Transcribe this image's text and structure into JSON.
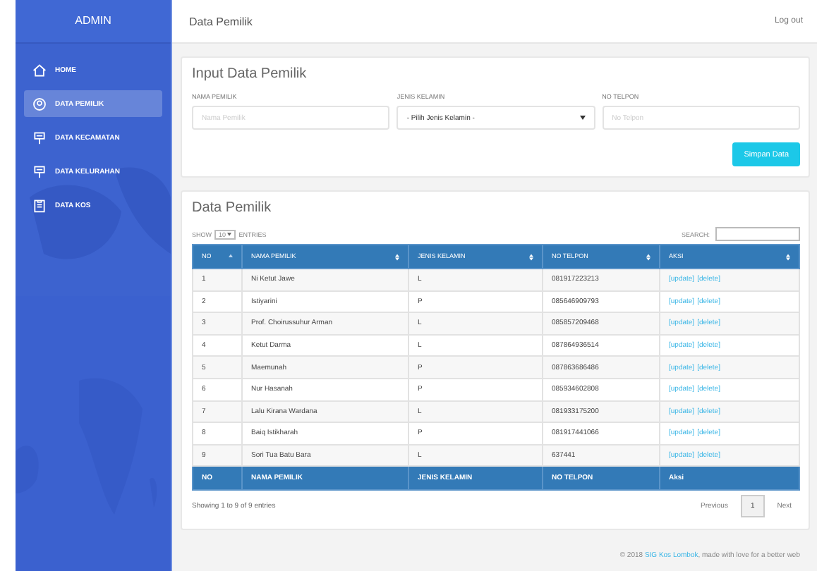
{
  "sidebar": {
    "title": "ADMIN",
    "items": [
      {
        "label": "HOME",
        "selected": false
      },
      {
        "label": "DATA PEMILIK",
        "selected": true
      },
      {
        "label": "DATA KECAMATAN",
        "selected": false
      },
      {
        "label": "DATA KELURAHAN",
        "selected": false
      },
      {
        "label": "DATA KOS",
        "selected": false
      }
    ]
  },
  "header": {
    "title": "Data Pemilik",
    "logout": "Log out"
  },
  "form": {
    "title": "Input Data Pemilik",
    "fields": [
      {
        "kind": "text",
        "label": "NAMA PEMILIK",
        "placeholder": "Nama Pemilik"
      },
      {
        "kind": "select",
        "label": "JENIS KELAMIN",
        "value": "- Pilih Jenis Kelamin -"
      },
      {
        "kind": "text",
        "label": "NO TELPON",
        "placeholder": "No Telpon"
      }
    ],
    "submit": "Simpan Data"
  },
  "table": {
    "title": "Data Pemilik",
    "show_label": "SHOW",
    "page_size": "10",
    "entries_label": "ENTRIES",
    "search_label": "SEARCH:",
    "columns": [
      {
        "label": "NO",
        "sorted": true
      },
      {
        "label": "NAMA PEMILIK",
        "sorted": false
      },
      {
        "label": "JENIS KELAMIN",
        "sorted": false
      },
      {
        "label": "NO TELPON",
        "sorted": false
      },
      {
        "label": "AKSI",
        "sorted": false
      }
    ],
    "rows": [
      {
        "cells": [
          "1",
          "Ni Ketut Jawe",
          "L",
          "081917223213"
        ],
        "actions": [
          "[update]",
          "[delete]"
        ]
      },
      {
        "cells": [
          "2",
          "Istiyarini",
          "P",
          "085646909793"
        ],
        "actions": [
          "[update]",
          "[delete]"
        ]
      },
      {
        "cells": [
          "3",
          "Prof. Choirussuhur Arman",
          "L",
          "085857209468"
        ],
        "actions": [
          "[update]",
          "[delete]"
        ]
      },
      {
        "cells": [
          "4",
          "Ketut Darma",
          "L",
          "087864936514"
        ],
        "actions": [
          "[update]",
          "[delete]"
        ]
      },
      {
        "cells": [
          "5",
          "Maemunah",
          "P",
          "087863686486"
        ],
        "actions": [
          "[update]",
          "[delete]"
        ]
      },
      {
        "cells": [
          "6",
          "Nur Hasanah",
          "P",
          "085934602808"
        ],
        "actions": [
          "[update]",
          "[delete]"
        ]
      },
      {
        "cells": [
          "7",
          "Lalu Kirana Wardana",
          "L",
          "081933175200"
        ],
        "actions": [
          "[update]",
          "[delete]"
        ]
      },
      {
        "cells": [
          "8",
          "Baiq Istikharah",
          "P",
          "081917441066"
        ],
        "actions": [
          "[update]",
          "[delete]"
        ]
      },
      {
        "cells": [
          "9",
          "Sori Tua Batu Bara",
          "L",
          "637441"
        ],
        "actions": [
          "[update]",
          "[delete]"
        ]
      }
    ],
    "footer": [
      "NO",
      "NAMA PEMILIK",
      "JENIS KELAMIN",
      "NO TELPON",
      "Aksi"
    ],
    "info": "Showing 1 to 9 of 9 entries",
    "pagination": [
      {
        "label": "Previous",
        "selected": false
      },
      {
        "label": "1",
        "selected": true
      },
      {
        "label": "Next",
        "selected": false
      }
    ]
  },
  "footer": {
    "prefix": "© 2018 ",
    "link": "SIG Kos Lombok",
    "suffix": ", made with love for a better web"
  }
}
